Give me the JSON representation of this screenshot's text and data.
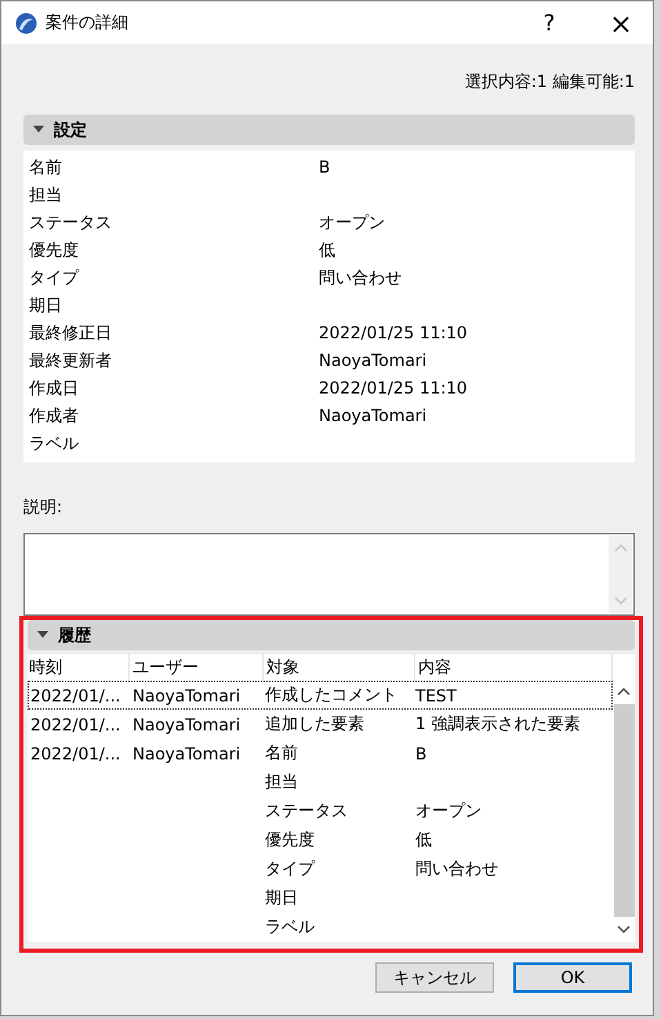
{
  "window": {
    "title": "案件の詳細",
    "help": "?",
    "close": "×"
  },
  "selection_info": "選択内容:1 編集可能:1",
  "settings": {
    "title": "設定",
    "expanded": true,
    "properties": [
      {
        "name": "名前",
        "value": "B"
      },
      {
        "name": "担当"
      },
      {
        "name": "ステータス",
        "value": "オープン"
      },
      {
        "name": "優先度",
        "value": "低"
      },
      {
        "name": "タイプ",
        "value": "問い合わせ"
      },
      {
        "name": "期日"
      },
      {
        "name": "最終修正日",
        "value": "2022/01/25 11:10"
      },
      {
        "name": "最終更新者",
        "value": "NaoyaTomari"
      },
      {
        "name": "作成日",
        "value": "2022/01/25 11:10"
      },
      {
        "name": "作成者",
        "value": "NaoyaTomari"
      },
      {
        "name": "ラベル"
      }
    ]
  },
  "description": {
    "label": "説明:"
  },
  "history": {
    "title": "履歴",
    "expanded": true,
    "highlighted": true,
    "columns": [
      "時刻",
      "ユーザー",
      "対象",
      "内容"
    ],
    "rows": [
      {
        "time": "2022/01/...",
        "user": "NaoyaTomari",
        "target": "作成したコメント",
        "content": "TEST",
        "selected": true
      },
      {
        "time": "2022/01/...",
        "user": "NaoyaTomari",
        "target": "追加した要素",
        "content": "1 強調表示された要素",
        "selected": false
      },
      {
        "time": "2022/01/...",
        "user": "NaoyaTomari",
        "target": "名前",
        "content": "B",
        "selected": false
      },
      {
        "target": "担当",
        "selected": false
      },
      {
        "target": "ステータス",
        "content": "オープン",
        "selected": false
      },
      {
        "target": "優先度",
        "content": "低",
        "selected": false
      },
      {
        "target": "タイプ",
        "content": "問い合わせ",
        "selected": false
      },
      {
        "target": "期日",
        "selected": false
      },
      {
        "target": "ラベル",
        "selected": false
      }
    ]
  },
  "buttons": [
    {
      "label": "キャンセル",
      "default": false
    },
    {
      "label": "OK",
      "default": true
    }
  ]
}
